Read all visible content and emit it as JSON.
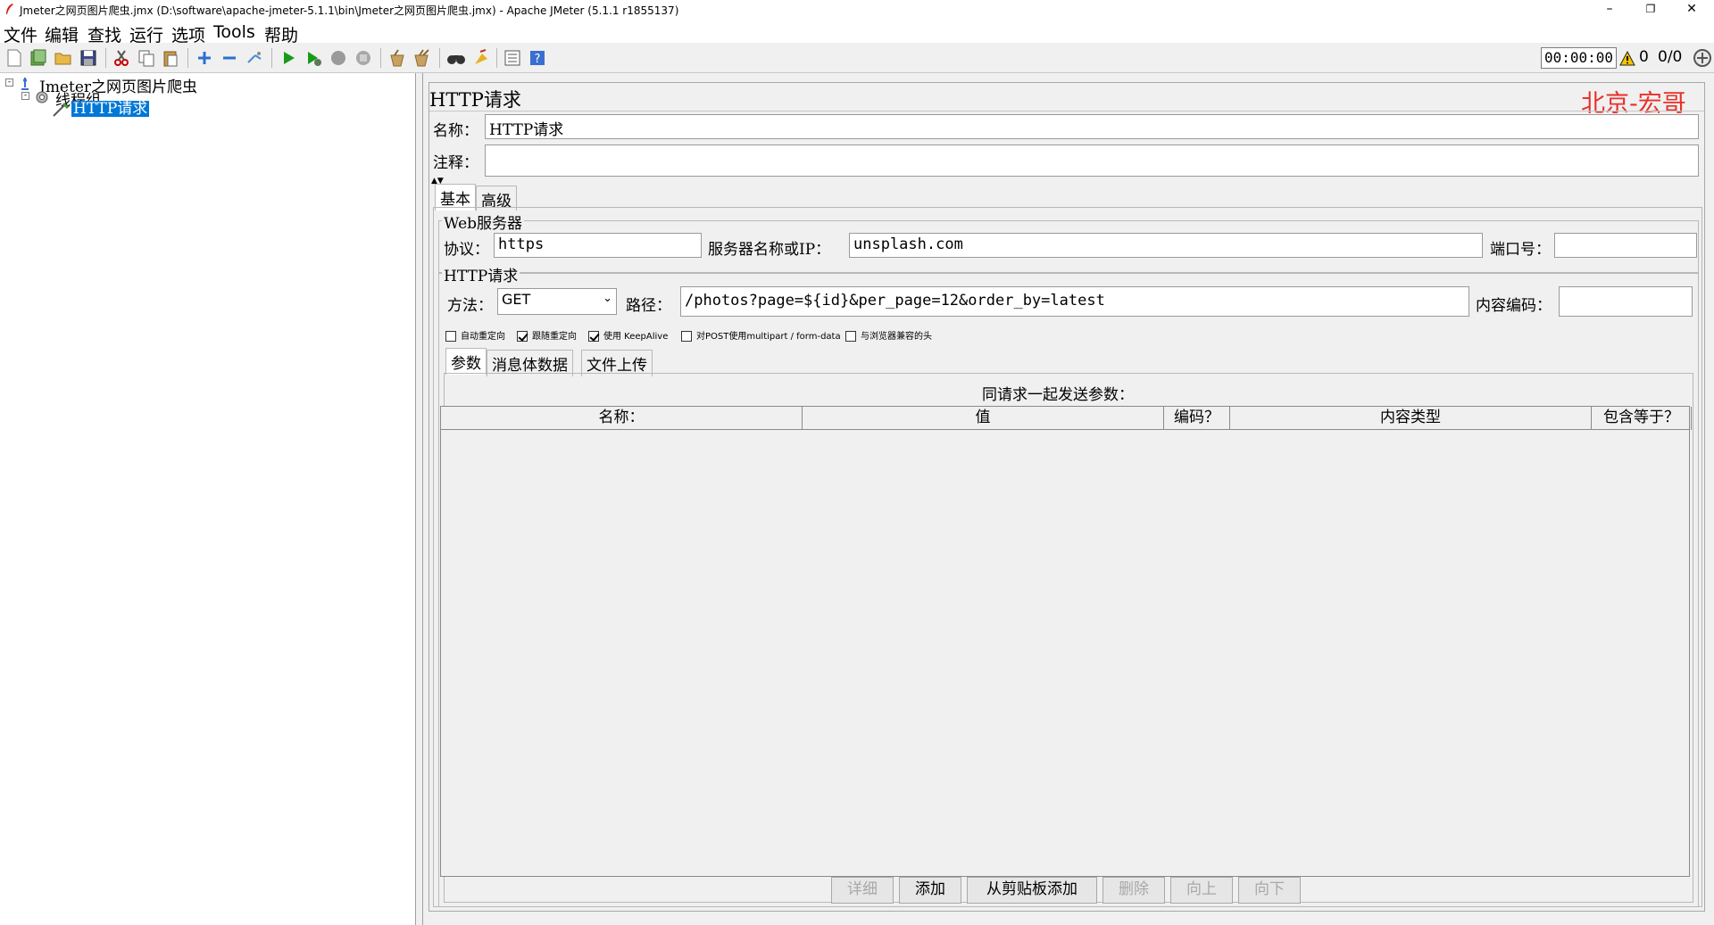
{
  "window": {
    "title": "Jmeter之网页图片爬虫.jmx (D:\\software\\apache-jmeter-5.1.1\\bin\\Jmeter之网页图片爬虫.jmx) - Apache JMeter (5.1.1 r1855137)",
    "minimize": "–",
    "restore": "❐",
    "close": "✕"
  },
  "menu": [
    "文件",
    "编辑",
    "查找",
    "运行",
    "选项",
    "Tools",
    "帮助"
  ],
  "toolbar": {
    "elapsed": "00:00:00",
    "warnings": "0",
    "threads": "0/0",
    "icons": [
      "new-icon",
      "templates-icon",
      "open-icon",
      "save-icon",
      "cut-icon",
      "copy-icon",
      "paste-icon",
      "expand-icon",
      "collapse-icon",
      "toggle-icon",
      "start-icon",
      "start-no-pause-icon",
      "stop-icon",
      "shutdown-icon",
      "clear-icon",
      "clear-all-icon",
      "search-icon",
      "reset-search-icon",
      "function-helper-icon",
      "help-icon"
    ]
  },
  "tree": {
    "root": "Jmeter之网页图片爬虫",
    "thread_group": "线程组",
    "sampler": "HTTP请求"
  },
  "panel": {
    "title": "HTTP请求",
    "watermark": "北京-宏哥",
    "name_label": "名称：",
    "name_value": "HTTP请求",
    "comment_label": "注释：",
    "comment_value": "",
    "tabs": [
      "基本",
      "高级"
    ],
    "web_server": {
      "title": "Web服务器",
      "protocol_label": "协议：",
      "protocol_value": "https",
      "server_label": "服务器名称或IP：",
      "server_value": "unsplash.com",
      "port_label": "端口号：",
      "port_value": ""
    },
    "http_request": {
      "title": "HTTP请求",
      "method_label": "方法：",
      "method_value": "GET",
      "path_label": "路径：",
      "path_value": "/photos?page=${id}&per_page=12&order_by=latest",
      "encoding_label": "内容编码：",
      "encoding_value": ""
    },
    "checkboxes": [
      {
        "label": "自动重定向",
        "checked": false
      },
      {
        "label": "跟随重定向",
        "checked": true
      },
      {
        "label": "使用 KeepAlive",
        "checked": true
      },
      {
        "label": "对POST使用multipart / form-data",
        "checked": false
      },
      {
        "label": "与浏览器兼容的头",
        "checked": false
      }
    ],
    "subtabs": [
      "参数",
      "消息体数据",
      "文件上传"
    ],
    "params_title": "同请求一起发送参数：",
    "columns": [
      "名称：",
      "值",
      "编码？",
      "内容类型",
      "包含等于？"
    ],
    "buttons": [
      {
        "label": "详细",
        "enabled": false
      },
      {
        "label": "添加",
        "enabled": true
      },
      {
        "label": "从剪贴板添加",
        "enabled": true
      },
      {
        "label": "删除",
        "enabled": false
      },
      {
        "label": "向上",
        "enabled": false
      },
      {
        "label": "向下",
        "enabled": false
      }
    ]
  },
  "colors": {
    "selection": "#0078d7",
    "watermark": "#e8302a",
    "run_green": "#1a9a1a"
  }
}
